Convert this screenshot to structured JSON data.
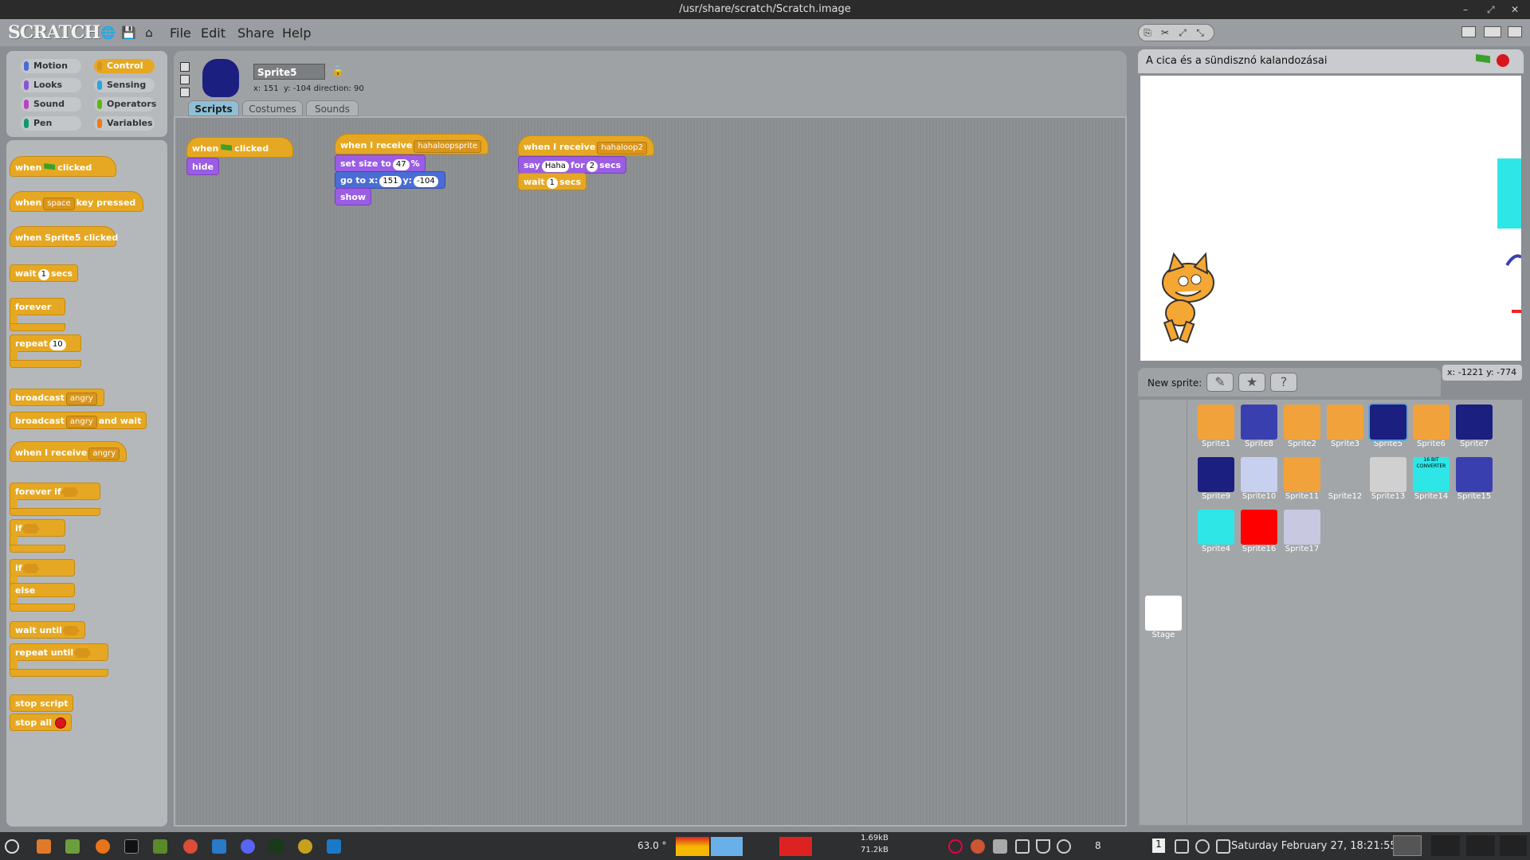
{
  "window": {
    "title": "/usr/share/scratch/Scratch.image",
    "controls": [
      "–",
      "⤢",
      "✕"
    ]
  },
  "menubar": {
    "logo": "SCRATCH",
    "items": [
      "File",
      "Edit",
      "Share",
      "Help"
    ]
  },
  "categories": [
    {
      "label": "Motion",
      "color": "#4a6cd4"
    },
    {
      "label": "Control",
      "color": "#e6a822",
      "selected": true
    },
    {
      "label": "Looks",
      "color": "#8a55d7"
    },
    {
      "label": "Sensing",
      "color": "#2ca5e2"
    },
    {
      "label": "Sound",
      "color": "#bb42c3"
    },
    {
      "label": "Operators",
      "color": "#5cb712"
    },
    {
      "label": "Pen",
      "color": "#0e9a6c"
    },
    {
      "label": "Variables",
      "color": "#ee7d16"
    }
  ],
  "palette": {
    "when_flag": [
      "when",
      "clicked"
    ],
    "when_key": [
      "when",
      "space",
      "key pressed"
    ],
    "when_sprite": "when Sprite5 clicked",
    "wait": [
      "wait",
      "1",
      "secs"
    ],
    "forever": "forever",
    "repeat": [
      "repeat",
      "10"
    ],
    "broadcast": [
      "broadcast",
      "angry"
    ],
    "broadcast_wait": [
      "broadcast",
      "angry",
      "and wait"
    ],
    "when_receive": [
      "when I receive",
      "angry"
    ],
    "forever_if": "forever if",
    "if": "if",
    "if_else": [
      "if",
      "else"
    ],
    "wait_until": "wait until",
    "repeat_until": "repeat until",
    "stop_script": "stop script",
    "stop_all": "stop all"
  },
  "sprite": {
    "name": "Sprite5",
    "x": "151",
    "y": "-104",
    "direction": "90"
  },
  "coords_labels": {
    "x": "x:",
    "y": "y:",
    "dir": "direction:"
  },
  "tabs": [
    "Scripts",
    "Costumes",
    "Sounds"
  ],
  "scripts": [
    {
      "hat": [
        "when",
        "clicked"
      ],
      "blocks": [
        "hide"
      ]
    },
    {
      "hat": [
        "when I receive",
        "hahaloopsprite"
      ],
      "set_size": [
        "set size to",
        "47",
        "%"
      ],
      "goto": [
        "go to x:",
        "151",
        "y:",
        "-104"
      ],
      "show": "show"
    },
    {
      "hat": [
        "when I receive",
        "hahaloop2"
      ],
      "say": [
        "say",
        "Haha",
        "for",
        "2",
        "secs"
      ],
      "wait": [
        "wait",
        "1",
        "secs"
      ]
    }
  ],
  "stage": {
    "title": "A cica és a sündisznó kalandozásai",
    "mouse_x": "-1221",
    "mouse_y": "-774",
    "mouse_labels": [
      "x:",
      "y:"
    ]
  },
  "new_sprite": {
    "label": "New sprite:"
  },
  "stage_thumb": {
    "label": "Stage"
  },
  "sprites": [
    {
      "name": "Sprite1",
      "color": "#f2a23a"
    },
    {
      "name": "Sprite8",
      "color": "#3a3fb0"
    },
    {
      "name": "Sprite2",
      "color": "#f2a23a"
    },
    {
      "name": "Sprite3",
      "color": "#f2a23a"
    },
    {
      "name": "Sprite5",
      "color": "#1a1f80",
      "selected": true
    },
    {
      "name": "Sprite6",
      "color": "#f2a23a"
    },
    {
      "name": "Sprite7",
      "color": "#1a1f80"
    },
    {
      "name": "Sprite9",
      "color": "#1a1f80"
    },
    {
      "name": "Sprite10",
      "color": "#c8d0f0"
    },
    {
      "name": "Sprite11",
      "color": "#f2a23a"
    },
    {
      "name": "Sprite12",
      "color": "#a3a6a9"
    },
    {
      "name": "Sprite13",
      "color": "#d0d0d0"
    },
    {
      "name": "Sprite14",
      "color": "#2ee6e6",
      "text": "16 BIT CONVERTER"
    },
    {
      "name": "Sprite15",
      "color": "#3a3fb0"
    },
    {
      "name": "Sprite4",
      "color": "#2ee6e6"
    },
    {
      "name": "Sprite16",
      "color": "#ff0000"
    },
    {
      "name": "Sprite17",
      "color": "#c8c8e0"
    }
  ],
  "taskbar": {
    "temp": "63.0 °",
    "net_up": "1.69kB",
    "net_down": "71.2kB",
    "workspace": "1",
    "notif": "8",
    "datetime": "Saturday February 27, 18:21:55"
  }
}
